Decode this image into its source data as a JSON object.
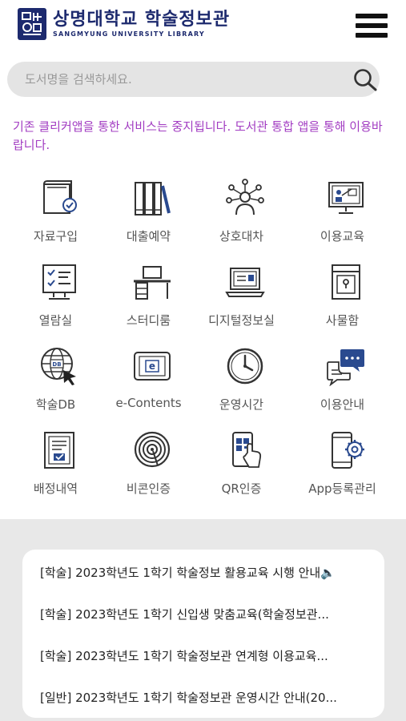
{
  "header": {
    "title": "상명대학교 학술정보관",
    "subtitle": "SANGMYUNG UNIVERSITY LIBRARY",
    "logo_icon": "sangmyung-logo",
    "menu_icon": "hamburger-menu-icon"
  },
  "search": {
    "placeholder": "도서명을 검색하세요.",
    "icon": "search-icon"
  },
  "notice": {
    "text": "기존 클리커앱을 통한 서비스는 중지됩니다. 도서관 통합 앱을 통해 이용바랍니다.",
    "color": "#a23cc2"
  },
  "menu": {
    "items": [
      {
        "label": "자료구입",
        "icon": "book-purchase-icon"
      },
      {
        "label": "대출예약",
        "icon": "books-shelf-icon"
      },
      {
        "label": "상호대차",
        "icon": "network-person-icon"
      },
      {
        "label": "이용교육",
        "icon": "teaching-board-icon"
      },
      {
        "label": "열람실",
        "icon": "checklist-monitor-icon"
      },
      {
        "label": "스터디룸",
        "icon": "desk-icon"
      },
      {
        "label": "디지털정보실",
        "icon": "laptop-icon"
      },
      {
        "label": "사물함",
        "icon": "locker-icon"
      },
      {
        "label": "학술DB",
        "icon": "globe-cursor-icon"
      },
      {
        "label": "e-Contents",
        "icon": "tablet-e-icon"
      },
      {
        "label": "운영시간",
        "icon": "clock-icon"
      },
      {
        "label": "이용안내",
        "icon": "chat-bubbles-icon"
      },
      {
        "label": "배정내역",
        "icon": "document-check-icon"
      },
      {
        "label": "비콘인증",
        "icon": "beacon-icon"
      },
      {
        "label": "QR인증",
        "icon": "phone-qr-icon"
      },
      {
        "label": "App등록관리",
        "icon": "phone-gear-icon"
      }
    ]
  },
  "news": {
    "items": [
      "[학술] 2023학년도 1학기 학술정보 활용교육 시행 안내🔈",
      "[학술] 2023학년도 1학기 신입생 맞춤교육(학술정보관...",
      "[학술] 2023학년도 1학기 학술정보관 연계형 이용교육...",
      "[일반] 2023학년도 1학기 학술정보관 운영시간 안내(20..."
    ]
  },
  "colors": {
    "brand": "#1d2a6e",
    "icon_stroke": "#333333",
    "icon_accent": "#2a4a8f",
    "news_background": "#e8e8e8"
  }
}
